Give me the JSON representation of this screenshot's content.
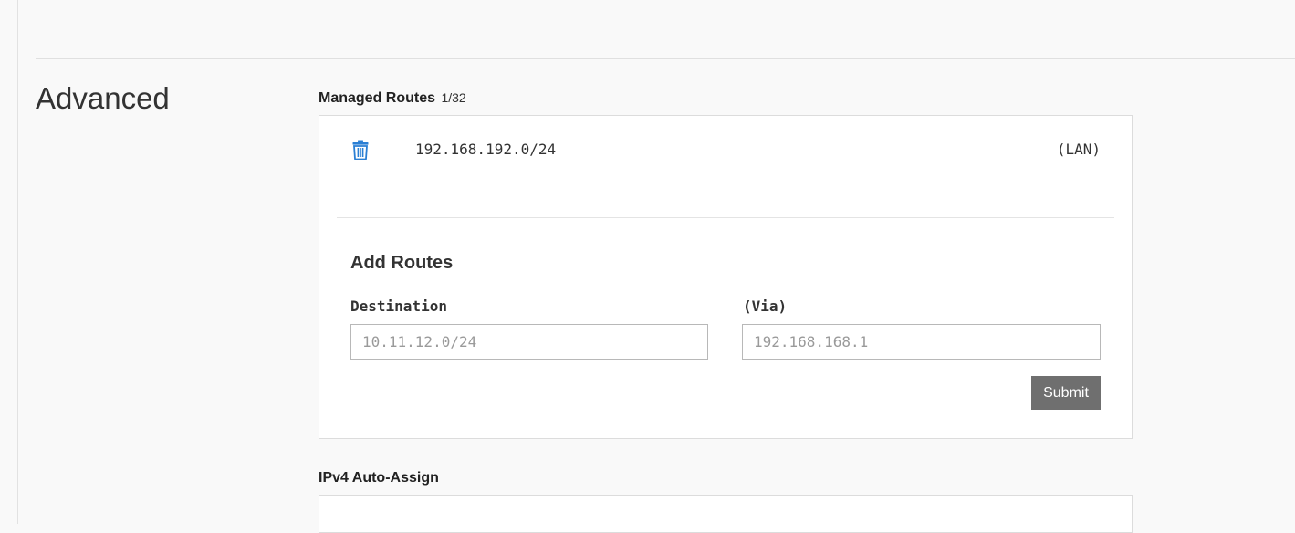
{
  "section": {
    "title": "Advanced"
  },
  "managed_routes": {
    "heading": "Managed Routes",
    "count": "1/32",
    "routes": [
      {
        "destination": "192.168.192.0/24",
        "via": "(LAN)",
        "delete_icon": "trash-icon"
      }
    ]
  },
  "add_routes": {
    "title": "Add Routes",
    "destination_label": "Destination",
    "destination_placeholder": "10.11.12.0/24",
    "destination_value": "",
    "via_label": "(Via)",
    "via_placeholder": "192.168.168.1",
    "via_value": "",
    "submit_label": "Submit"
  },
  "ipv4": {
    "heading": "IPv4 Auto-Assign"
  },
  "colors": {
    "accent": "#2a7fd4",
    "button_bg": "#6f6f6f",
    "page_bg": "#f9f9f9"
  }
}
